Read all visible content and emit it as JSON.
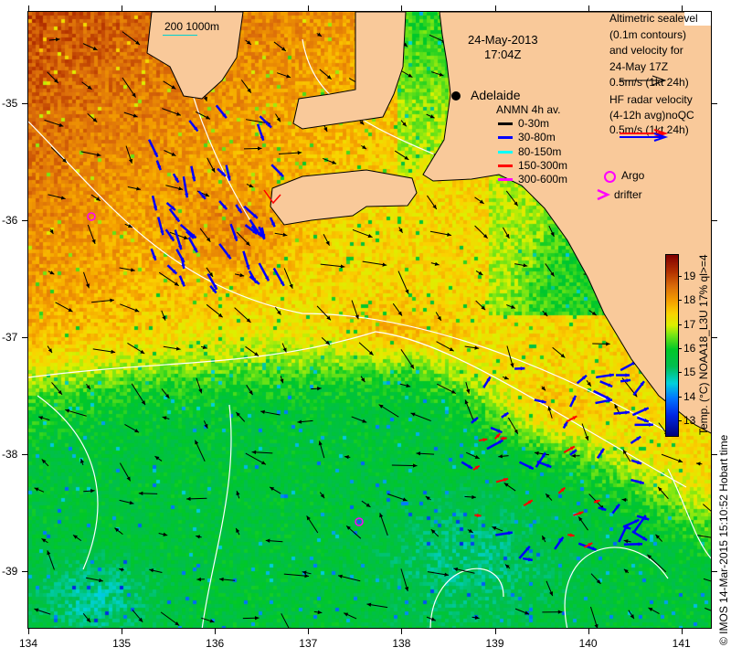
{
  "scale_label": "200  1000m",
  "date": "24-May-2013",
  "time": "17:04Z",
  "city": {
    "name": "Adelaide",
    "icon": "city-dot-icon"
  },
  "altimetry_legend": [
    "Altimetric sealevel",
    "(0.1m contours)",
    "and velocity for",
    "24-May 17Z",
    "0.5m/s (1kt 24h)"
  ],
  "hf_radar_legend": [
    "HF radar velocity",
    "(4-12h avg)noQC",
    "0.5m/s (1kt 24h)"
  ],
  "anmn_legend": {
    "title": "ANMN 4h av.",
    "items": [
      {
        "label": "0-30m",
        "color": "#000000"
      },
      {
        "label": "30-80m",
        "color": "#0000ff"
      },
      {
        "label": "80-150m",
        "color": "#00ffff"
      },
      {
        "label": "150-300m",
        "color": "#ff0000"
      },
      {
        "label": "300-600m",
        "color": "#ff00ff"
      }
    ]
  },
  "argo_label": "Argo",
  "drifter_label": "drifter",
  "axes": {
    "lon_ticks": [
      "134",
      "135",
      "136",
      "137",
      "138",
      "139",
      "140",
      "141"
    ],
    "lat_ticks": [
      "-35",
      "-36",
      "-37",
      "-38",
      "-39"
    ]
  },
  "colorbar": {
    "ticks": [
      "19",
      "18",
      "17",
      "16",
      "15",
      "14",
      "13"
    ],
    "range": [
      12.4,
      19.9
    ],
    "label": "Temp. (°C) NOAA18_L3U 17% ql>=4"
  },
  "colors": {
    "land": "#f9c99a",
    "radar_red": "#ff0000",
    "radar_blue": "#0000ff",
    "argo": "#ff00ff"
  },
  "credit": "© IMOS 14-Mar-2015 15:10:52 Hobart time"
}
